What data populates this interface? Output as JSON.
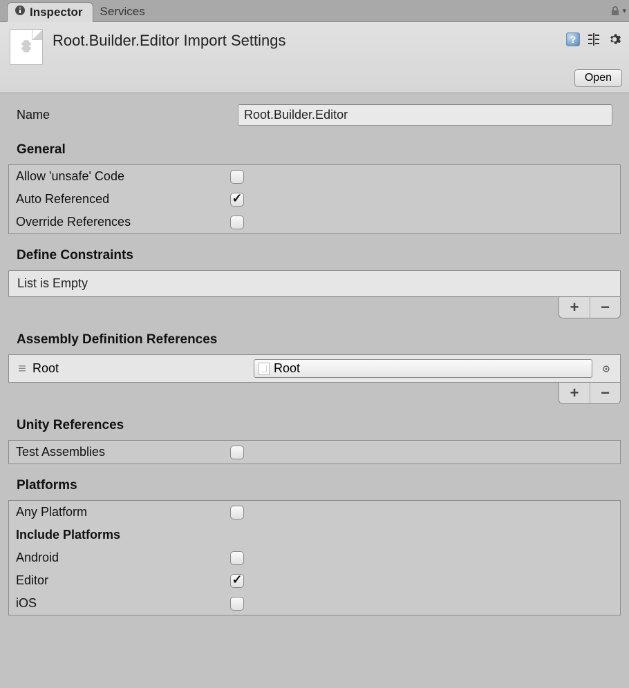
{
  "tabs": {
    "inspector": "Inspector",
    "services": "Services"
  },
  "header": {
    "title": "Root.Builder.Editor Import Settings",
    "open": "Open"
  },
  "name": {
    "label": "Name",
    "value": "Root.Builder.Editor"
  },
  "general": {
    "title": "General",
    "allow_unsafe": {
      "label": "Allow 'unsafe' Code",
      "checked": false
    },
    "auto_referenced": {
      "label": "Auto Referenced",
      "checked": true
    },
    "override_refs": {
      "label": "Override References",
      "checked": false
    }
  },
  "define_constraints": {
    "title": "Define Constraints",
    "empty_text": "List is Empty"
  },
  "asm_refs": {
    "title": "Assembly Definition References",
    "items": [
      {
        "label": "Root",
        "value": "Root"
      }
    ]
  },
  "unity_refs": {
    "title": "Unity References",
    "test_assemblies": {
      "label": "Test Assemblies",
      "checked": false
    }
  },
  "platforms": {
    "title": "Platforms",
    "any_platform": {
      "label": "Any Platform",
      "checked": false
    },
    "include_title": "Include Platforms",
    "items": [
      {
        "label": "Android",
        "checked": false
      },
      {
        "label": "Editor",
        "checked": true
      },
      {
        "label": "iOS",
        "checked": false
      }
    ]
  }
}
